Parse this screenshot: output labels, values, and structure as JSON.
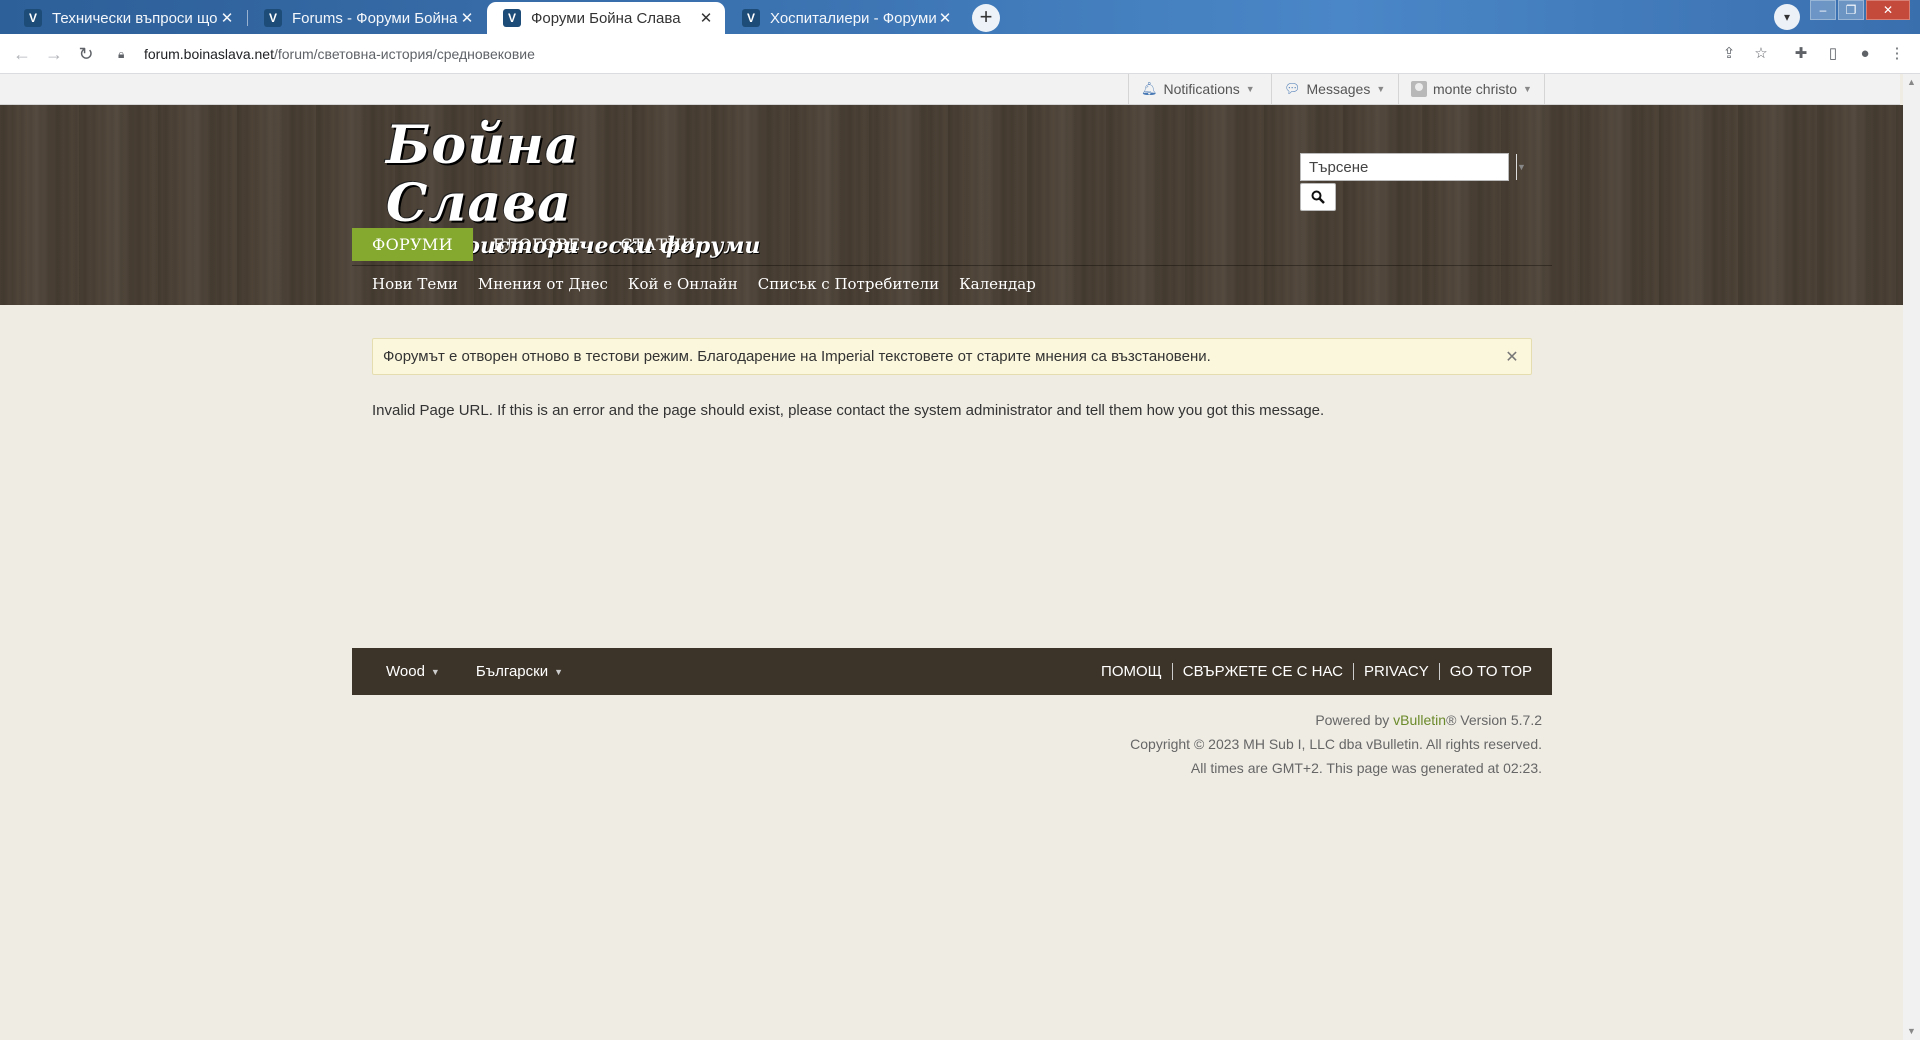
{
  "browser": {
    "tabs": [
      {
        "title": "Технически въпроси що"
      },
      {
        "title": "Forums - Форуми Бойна С"
      },
      {
        "title": "Форуми Бойна Слава"
      },
      {
        "title": "Хоспиталиери - Форуми"
      }
    ],
    "tab_close": "✕",
    "new_tab": "+",
    "url_host": "forum.boinaslava.net",
    "url_path": "/forum/световна-история/средновековие"
  },
  "userbar": {
    "notifications": "Notifications",
    "messages": "Messages",
    "username": "monte christo"
  },
  "header": {
    "logo_title": "Бойна Слава",
    "logo_subtitle": "Военноисторически форуми",
    "search_placeholder": "Търсене"
  },
  "mainnav": [
    {
      "label": "ФОРУМИ",
      "active": true
    },
    {
      "label": "БЛОГОВЕ",
      "active": false
    },
    {
      "label": "СТАТИИ",
      "active": false
    }
  ],
  "subnav": [
    "Нови Теми",
    "Мнения от Днес",
    "Кой е Онлайн",
    "Списък с Потребители",
    "Календар"
  ],
  "notice": {
    "text": "Форумът е отворен отново в тестови режим. Благодарение на Imperial текстовете от старите мнения са възстановени.",
    "close": "✕"
  },
  "error_message": "Invalid Page URL. If this is an error and the page should exist, please contact the system administrator and tell them how you got this message.",
  "footer": {
    "style_select": "Wood",
    "language_select": "Български",
    "links": [
      "ПОМОЩ",
      "СВЪРЖЕТЕ СЕ С НАС",
      "PRIVACY",
      "GO TO TOP"
    ]
  },
  "copyright": {
    "powered_prefix": "Powered by",
    "powered_brand": "vBulletin",
    "powered_suffix": "® Version 5.7.2",
    "copyright_line": "Copyright © 2023 MH Sub I, LLC dba vBulletin. All rights reserved.",
    "time_line": "All times are GMT+2. This page was generated at 02:23."
  },
  "colors": {
    "accent_green": "#84a92e",
    "header_wood": "#4f4438",
    "footer_bar": "#3d3429",
    "notice_bg": "#fbf7dc"
  }
}
